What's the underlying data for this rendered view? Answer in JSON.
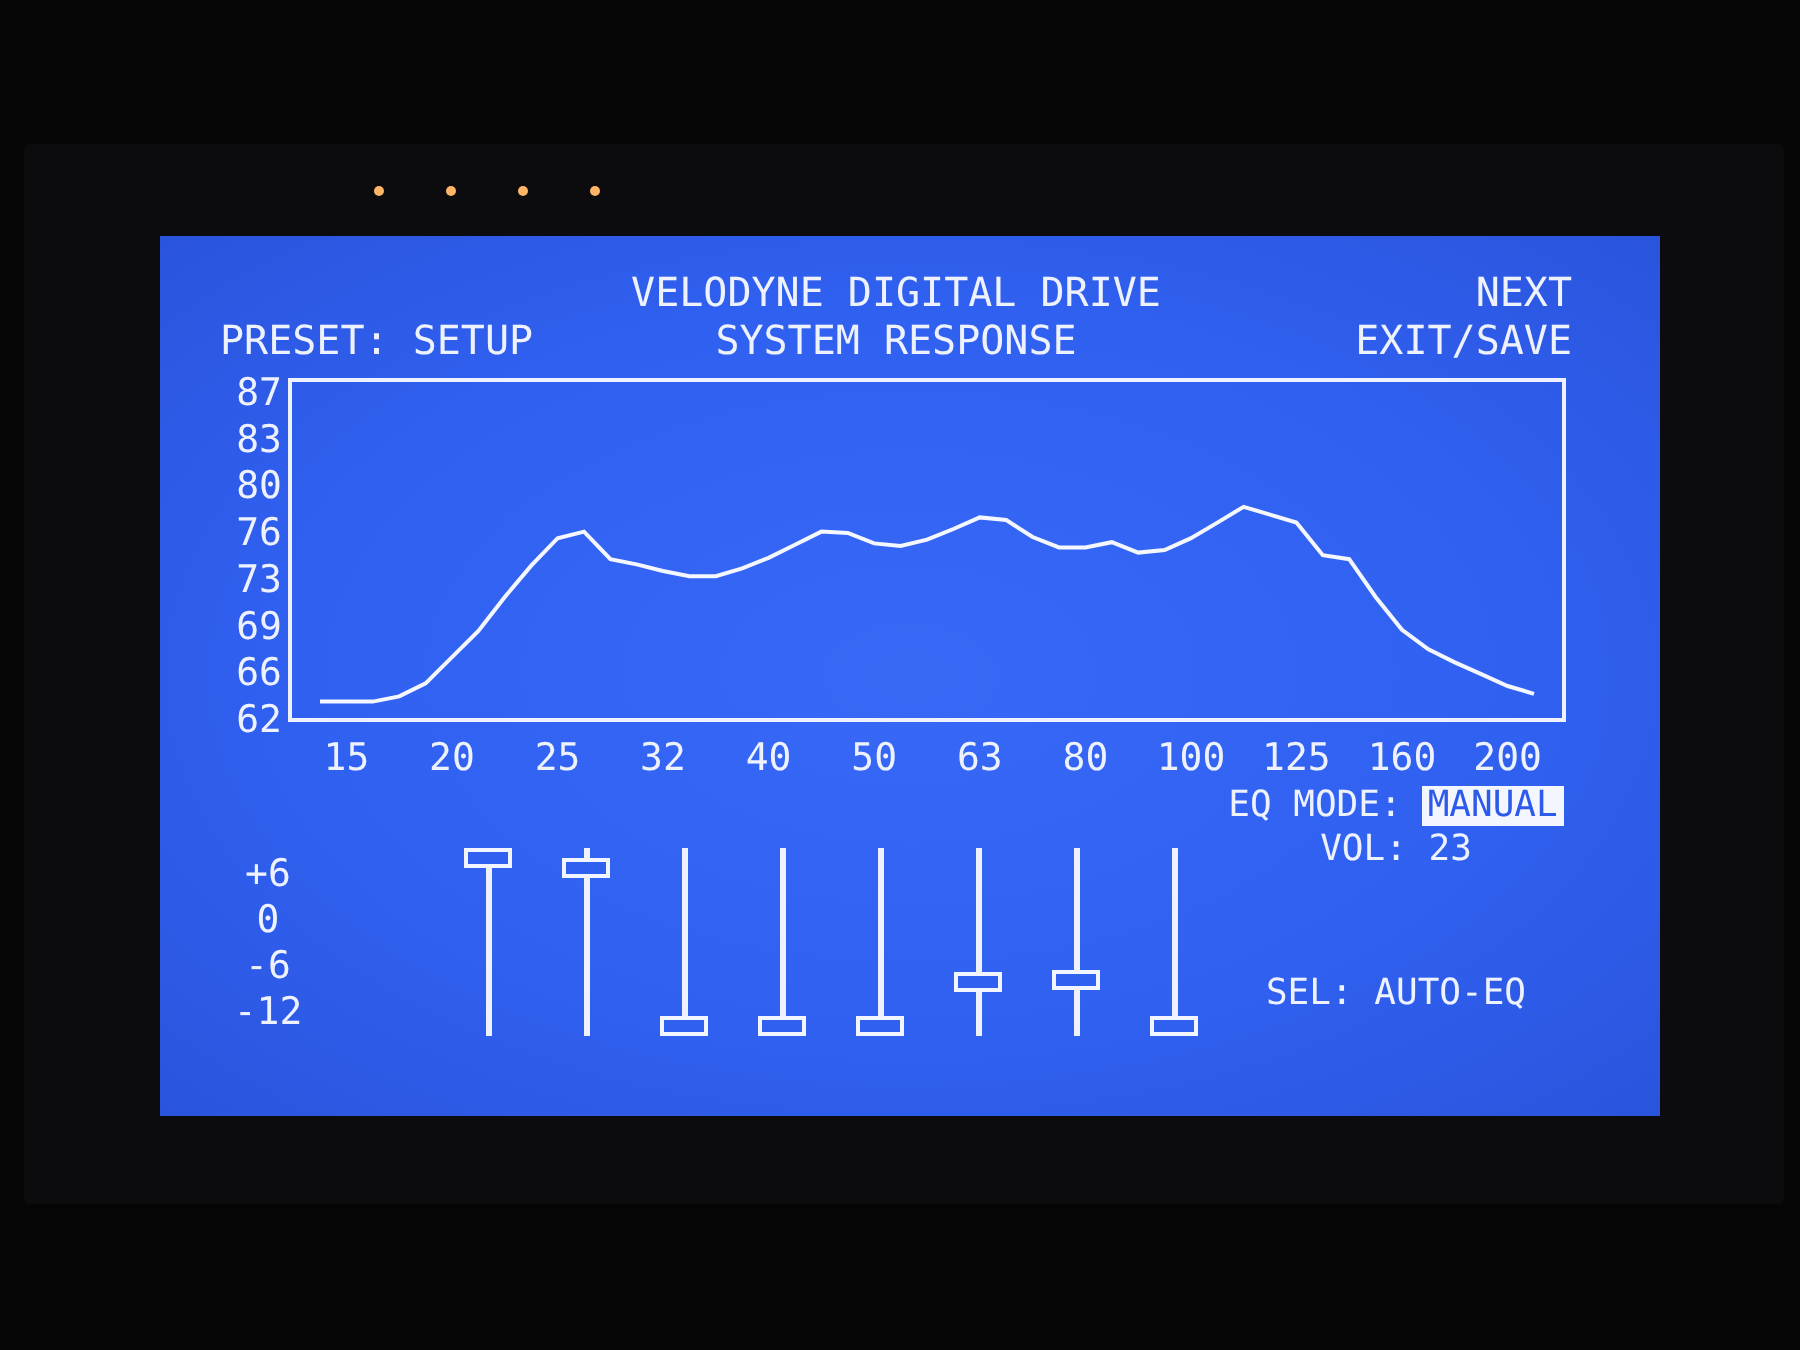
{
  "tv_lights": [
    {
      "on": true
    },
    {
      "on": true
    },
    {
      "on": true
    },
    {
      "on": true
    }
  ],
  "header": {
    "preset": "PRESET: SETUP",
    "title": "VELODYNE DIGITAL DRIVE",
    "subtitle": "SYSTEM RESPONSE",
    "menu": [
      {
        "label": "NEXT"
      },
      {
        "label": "EXIT/SAVE"
      }
    ]
  },
  "response": {
    "chart_data": {
      "type": "line",
      "categories": [
        null,
        "15",
        null,
        null,
        null,
        "20",
        null,
        null,
        null,
        "25",
        null,
        null,
        null,
        "32",
        null,
        null,
        null,
        "40",
        null,
        null,
        null,
        "50",
        null,
        null,
        null,
        "63",
        null,
        null,
        null,
        "80",
        null,
        null,
        null,
        "100",
        null,
        null,
        null,
        "125",
        null,
        null,
        null,
        "160",
        null,
        null,
        null,
        "200",
        null
      ],
      "values": [
        63.4,
        63.4,
        63.4,
        63.8,
        64.8,
        66.8,
        68.8,
        71.4,
        73.8,
        75.9,
        76.4,
        74.3,
        73.9,
        73.4,
        73.0,
        73.0,
        73.6,
        74.4,
        75.4,
        76.4,
        76.3,
        75.5,
        75.3,
        75.8,
        76.6,
        77.5,
        77.3,
        76.0,
        75.2,
        75.2,
        75.6,
        74.8,
        75.0,
        75.9,
        77.1,
        78.3,
        77.7,
        77.1,
        74.6,
        74.3,
        71.4,
        68.9,
        67.4,
        66.4,
        65.5,
        64.6,
        64.0
      ],
      "ylim": [
        62,
        88
      ],
      "yticks": [
        62,
        {
          "value": 65.57,
          "label": "66"
        },
        {
          "value": 69.14,
          "label": "69"
        },
        {
          "value": 72.71,
          "label": "73"
        },
        {
          "value": 76.29,
          "label": "76"
        },
        {
          "value": 79.86,
          "label": "80"
        },
        {
          "value": 83.43,
          "label": "83"
        },
        87
      ]
    }
  },
  "eq": {
    "scale": [
      "+6",
      "0",
      "-6",
      "-12"
    ],
    "sliders": [
      {
        "level": 1
      },
      {
        "level": 0.94
      },
      {
        "level": 0
      },
      {
        "level": 0
      },
      {
        "level": 0
      },
      {
        "level": 0.26
      },
      {
        "level": 0.28
      },
      {
        "level": 0
      }
    ]
  },
  "eq_mode": {
    "label": "EQ MODE:",
    "value": "MANUAL",
    "highlighted": true
  },
  "volume": "VOL: 23",
  "sel": "SEL: AUTO-EQ"
}
